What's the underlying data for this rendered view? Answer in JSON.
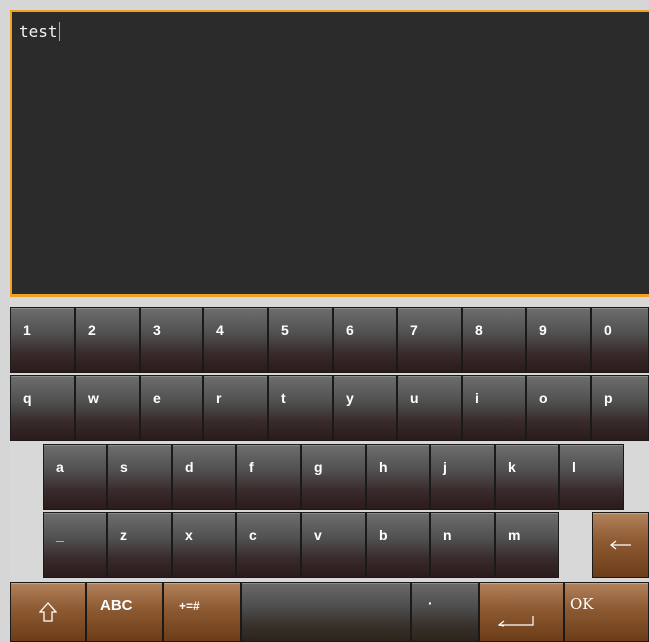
{
  "editor": {
    "text": "test"
  },
  "keyboard": {
    "row1": [
      "1",
      "2",
      "3",
      "4",
      "5",
      "6",
      "7",
      "8",
      "9",
      "0"
    ],
    "row2": [
      "q",
      "w",
      "e",
      "r",
      "t",
      "y",
      "u",
      "i",
      "o",
      "p"
    ],
    "row3": [
      "a",
      "s",
      "d",
      "f",
      "g",
      "h",
      "j",
      "k",
      "l"
    ],
    "row4": [
      "_",
      "z",
      "x",
      "c",
      "v",
      "b",
      "n",
      "m"
    ],
    "bottom": {
      "abc": "ABC",
      "symbols": "+=#",
      "dot": "·",
      "ok": "OK"
    },
    "icons": {
      "shift": "shift-arrow-icon",
      "backspace": "backspace-arrow-icon",
      "enter": "enter-icon"
    },
    "colors": {
      "accent": "#f0a024",
      "editor_bg": "#2b2b2b",
      "action_key": "#8d5a32"
    }
  }
}
